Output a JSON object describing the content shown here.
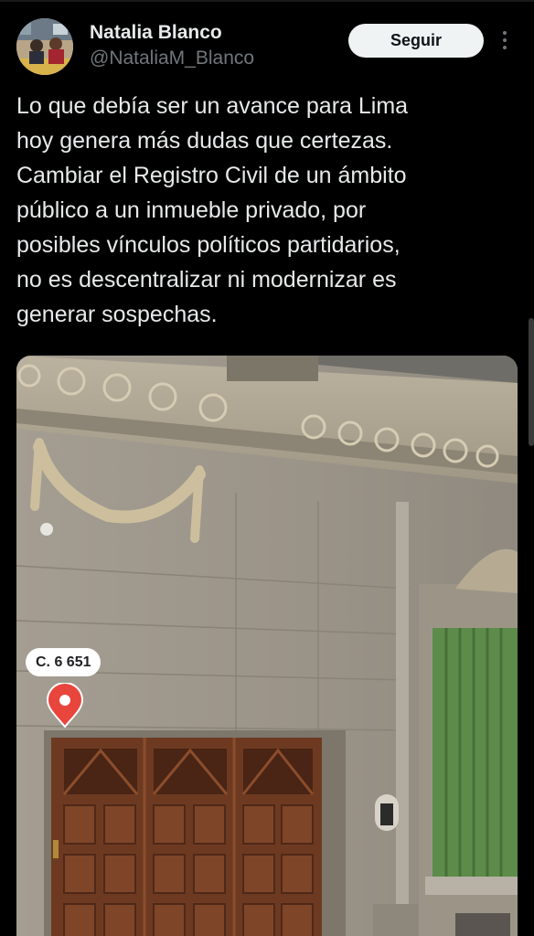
{
  "author": {
    "display_name": "Natalia Blanco",
    "handle": "@NataliaM_Blanco"
  },
  "actions": {
    "follow_label": "Seguir",
    "more_icon": "more-vertical-icon"
  },
  "tweet": {
    "text": "Lo que debía ser un avance para Lima\nhoy genera más dudas que certezas.\nCambiar el Registro Civil de un ámbito\npúblico a un inmueble privado, por\nposibles vínculos políticos partidarios,\nno es descentralizar ni modernizar es\ngenerar sospechas."
  },
  "media": {
    "pin_label": "C. 6 651",
    "pin_icon": "map-pin-icon"
  },
  "colors": {
    "background": "#000000",
    "text": "#e7e9ea",
    "secondary_text": "#71767b",
    "button_bg": "#eff3f4",
    "pin_red": "#e8453c"
  }
}
